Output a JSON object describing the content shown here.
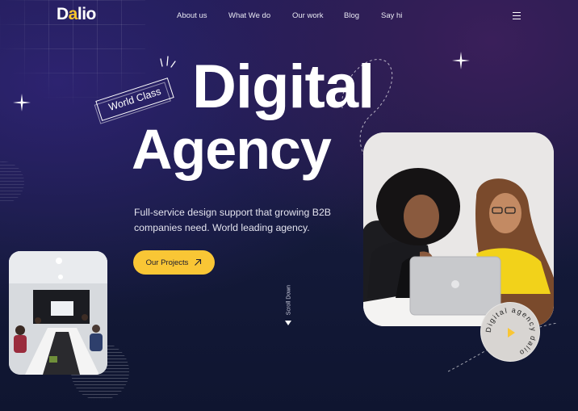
{
  "brand": {
    "logo_prefix": "D",
    "logo_dot": "a",
    "logo_suffix": "lio"
  },
  "nav": {
    "items": [
      {
        "label": "About us"
      },
      {
        "label": "What We do"
      },
      {
        "label": "Our work"
      },
      {
        "label": "Blog"
      },
      {
        "label": "Say hi"
      }
    ],
    "menu_icon": "hamburger-menu-icon"
  },
  "hero": {
    "badge": "World Class",
    "title_line1": "Digital",
    "title_line2": "Agency",
    "subtitle_line1": "Full-service design support that growing B2B",
    "subtitle_line2": "companies need. World leading agency.",
    "cta_label": "Our Projects",
    "cta_icon": "arrow-up-right-icon",
    "scroll_label": "Scroll Down",
    "scroll_icon": "arrow-down-icon"
  },
  "circle_badge": {
    "text": "Digital agency dalio",
    "center_icon": "play-triangle-icon"
  },
  "colors": {
    "accent": "#f9c635",
    "background_top": "#1d1b4d",
    "background_bottom": "#0f1530",
    "text_primary": "#ffffff"
  }
}
